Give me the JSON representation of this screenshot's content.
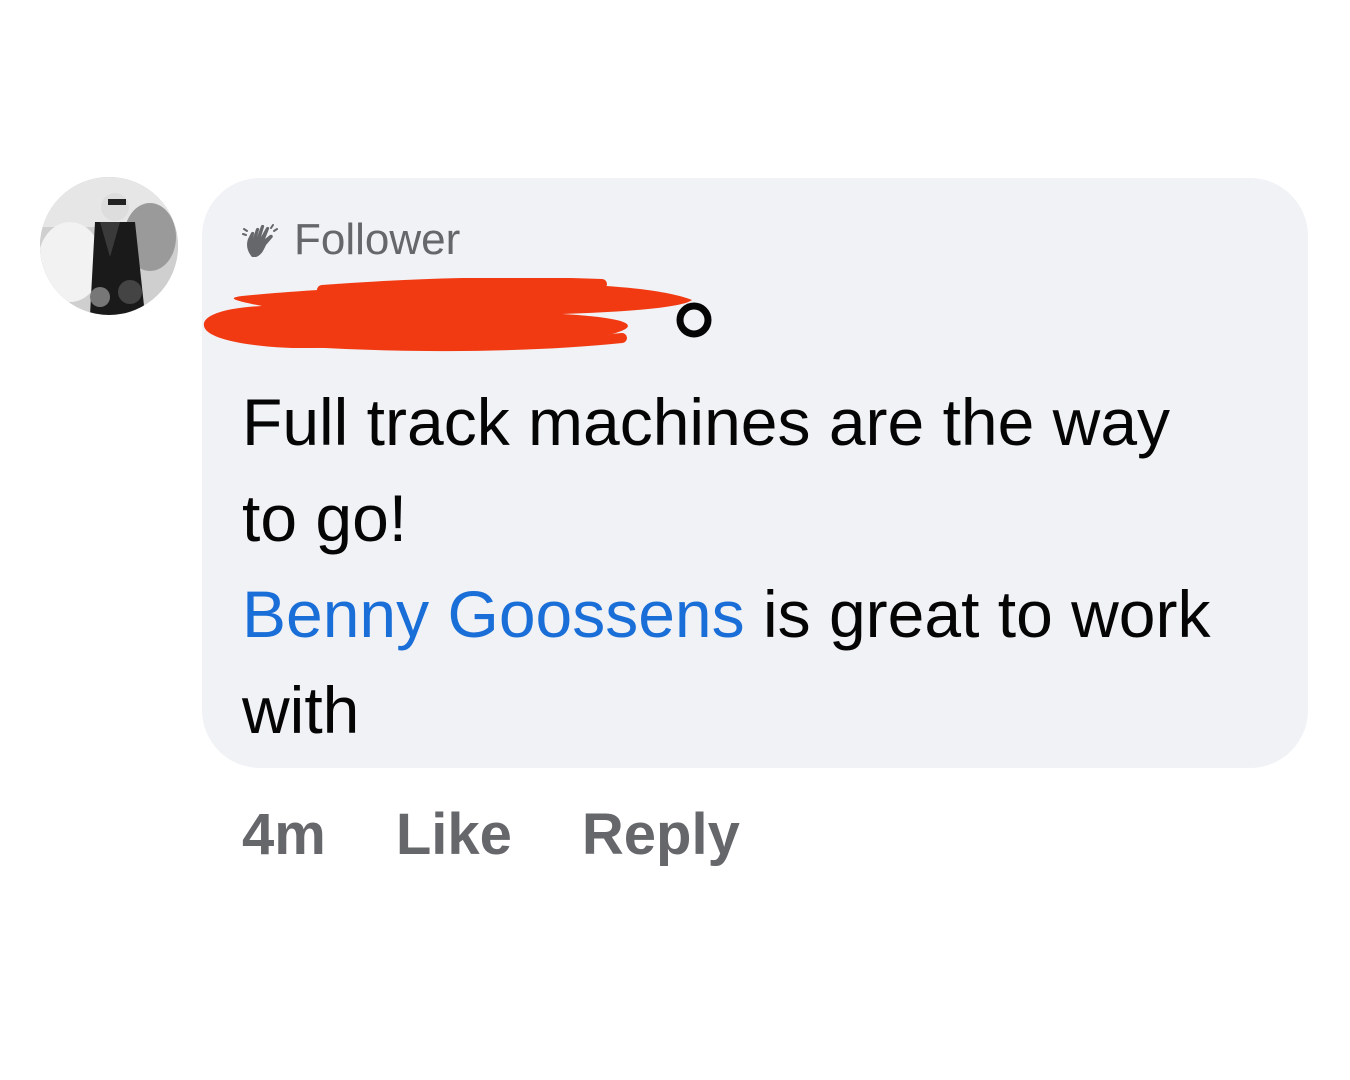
{
  "comment": {
    "badge_label": "Follower",
    "badge_icon": "waving-hand-icon",
    "author_name": "",
    "text_line": "Full track machines are the way to go!",
    "mention_name": "Benny Goossens",
    "mention_suffix": " is great to work with",
    "colors": {
      "bubble_bg": "#f0f2f5",
      "text": "#050505",
      "muted": "#65676b",
      "mention": "#1a6ed8",
      "redaction": "#f23a12"
    }
  },
  "actions": {
    "timestamp": "4m",
    "like_label": "Like",
    "reply_label": "Reply"
  }
}
